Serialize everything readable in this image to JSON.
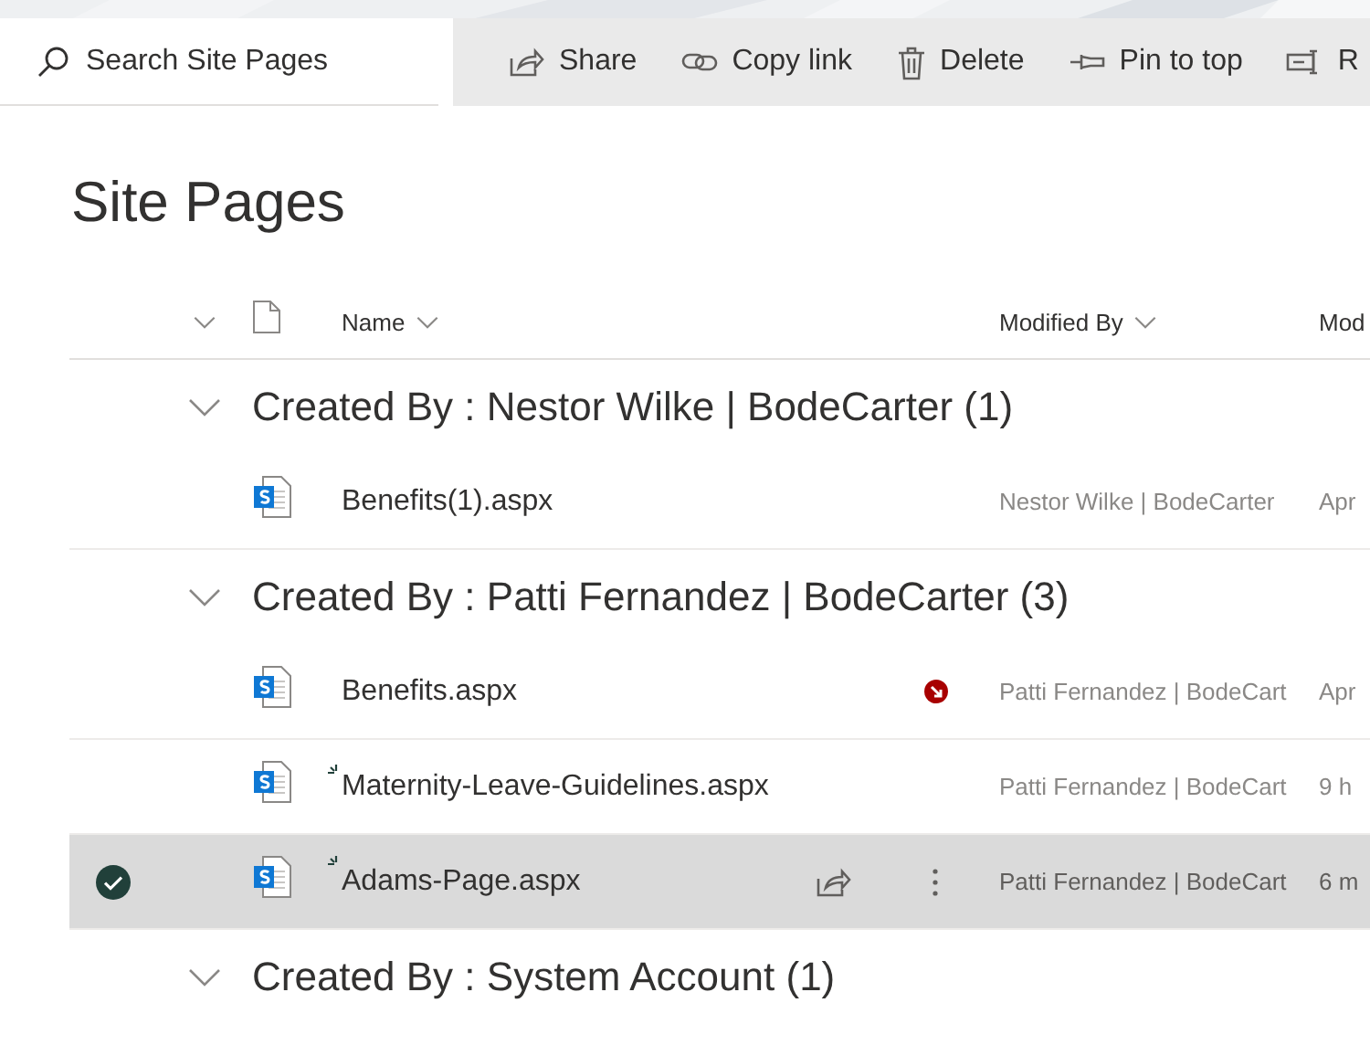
{
  "search": {
    "placeholder": "Search Site Pages"
  },
  "commands": [
    {
      "kind": "share",
      "label": "Share"
    },
    {
      "kind": "link",
      "label": "Copy link"
    },
    {
      "kind": "delete",
      "label": "Delete"
    },
    {
      "kind": "pin",
      "label": "Pin to top"
    },
    {
      "kind": "rename",
      "label": "R"
    }
  ],
  "title": "Site Pages",
  "columns": [
    {
      "label": "Name",
      "dropdown": true
    },
    {
      "label": "Modified By",
      "dropdown": true
    },
    {
      "label": "Mod"
    }
  ],
  "groups": [
    {
      "title": "Created By : Nestor Wilke | BodeCarter (1)",
      "expanded": true,
      "rows": [
        {
          "name": "Benefits(1).aspx",
          "new": false,
          "alert": false,
          "selected": false,
          "modified_by": "Nestor Wilke | BodeCarter",
          "modified": "Apr"
        }
      ]
    },
    {
      "title": "Created By : Patti Fernandez | BodeCarter (3)",
      "expanded": true,
      "rows": [
        {
          "name": "Benefits.aspx",
          "new": false,
          "alert": true,
          "selected": false,
          "modified_by": "Patti Fernandez | BodeCart",
          "modified": "Apr"
        },
        {
          "name": "Maternity-Leave-Guidelines.aspx",
          "new": true,
          "alert": false,
          "selected": false,
          "modified_by": "Patti Fernandez | BodeCart",
          "modified": "9 h"
        },
        {
          "name": "Adams-Page.aspx",
          "new": true,
          "alert": false,
          "selected": true,
          "modified_by": "Patti Fernandez | BodeCart",
          "modified": "6 m"
        }
      ]
    },
    {
      "title": "Created By : System Account (1)",
      "expanded": true
    }
  ]
}
